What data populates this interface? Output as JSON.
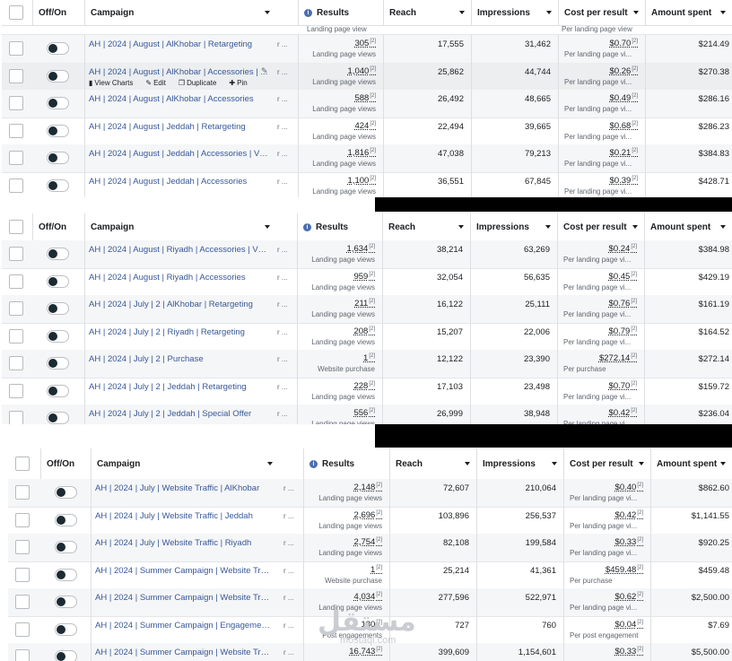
{
  "columns": {
    "toggle": "Off/On",
    "campaign": "Campaign",
    "results": "Results",
    "reach": "Reach",
    "impressions": "Impressions",
    "cpr": "Cost per result",
    "spent": "Amount spent"
  },
  "row_actions": {
    "view_charts": "View Charts",
    "edit": "Edit",
    "duplicate": "Duplicate",
    "pin": "Pin"
  },
  "truncation_text": "r ...",
  "panel1": {
    "top_partial": {
      "results_sub": "Landing page view",
      "cpr_sub": "Per landing page view"
    },
    "rows": [
      {
        "campaign": "AH | 2024 | August | AlKhobar | Retargeting",
        "results": "305",
        "results_sub": "Landing page views",
        "reach": "17,555",
        "impressions": "31,462",
        "cpr": "$0.70",
        "cpr_sub": "Per landing page vi...",
        "spent": "$214.49"
      },
      {
        "campaign": "AH | 2024 | August | AlKhobar | Accessories | ...",
        "results": "1,040",
        "results_sub": "Landing page views",
        "reach": "25,862",
        "impressions": "44,744",
        "cpr": "$0.26",
        "cpr_sub": "Per landing page vi...",
        "spent": "$270.38"
      },
      {
        "campaign": "AH | 2024 | August | AlKhobar | Accessories",
        "results": "588",
        "results_sub": "Landing page views",
        "reach": "26,492",
        "impressions": "48,665",
        "cpr": "$0.49",
        "cpr_sub": "Per landing page vi...",
        "spent": "$286.16"
      },
      {
        "campaign": "AH | 2024 | August | Jeddah | Retargeting",
        "results": "424",
        "results_sub": "Landing page views",
        "reach": "22,494",
        "impressions": "39,665",
        "cpr": "$0.68",
        "cpr_sub": "Per landing page vi...",
        "spent": "$286.23"
      },
      {
        "campaign": "AH | 2024 | August | Jeddah | Accessories | Vide...",
        "results": "1,816",
        "results_sub": "Landing page views",
        "reach": "47,038",
        "impressions": "79,213",
        "cpr": "$0.21",
        "cpr_sub": "Per landing page vi...",
        "spent": "$384.83"
      },
      {
        "campaign": "AH | 2024 | August | Jeddah | Accessories",
        "results": "1,100",
        "results_sub": "Landing page views",
        "reach": "36,551",
        "impressions": "67,845",
        "cpr": "$0.39",
        "cpr_sub": "Per landing page vi...",
        "spent": "$428.71"
      }
    ]
  },
  "panel2": {
    "rows": [
      {
        "campaign": "AH | 2024 | August | Riyadh | Accessories | Vide...",
        "results": "1,634",
        "results_sub": "Landing page views",
        "reach": "38,214",
        "impressions": "63,269",
        "cpr": "$0.24",
        "cpr_sub": "Per landing page vi...",
        "spent": "$384.98"
      },
      {
        "campaign": "AH | 2024 | August | Riyadh | Accessories",
        "results": "959",
        "results_sub": "Landing page views",
        "reach": "32,054",
        "impressions": "56,635",
        "cpr": "$0.45",
        "cpr_sub": "Per landing page vi...",
        "spent": "$429.19"
      },
      {
        "campaign": "AH | 2024 | July | 2 | AlKhobar | Retargeting",
        "results": "211",
        "results_sub": "Landing page views",
        "reach": "16,122",
        "impressions": "25,111",
        "cpr": "$0.76",
        "cpr_sub": "Per landing page vi...",
        "spent": "$161.19"
      },
      {
        "campaign": "AH | 2024 | July | 2 | Riyadh | Retargeting",
        "results": "208",
        "results_sub": "Landing page views",
        "reach": "15,207",
        "impressions": "22,006",
        "cpr": "$0.79",
        "cpr_sub": "Per landing page vi...",
        "spent": "$164.52"
      },
      {
        "campaign": "AH | 2024 | July | 2 | Purchase",
        "results": "1",
        "results_sub": "Website purchase",
        "reach": "12,122",
        "impressions": "23,390",
        "cpr": "$272.14",
        "cpr_sub": "Per purchase",
        "spent": "$272.14"
      },
      {
        "campaign": "AH | 2024 | July | 2 | Jeddah | Retargeting",
        "results": "228",
        "results_sub": "Landing page views",
        "reach": "17,103",
        "impressions": "23,498",
        "cpr": "$0.70",
        "cpr_sub": "Per landing page vi...",
        "spent": "$159.72"
      },
      {
        "campaign": "AH | 2024 | July | 2 | Jeddah | Special Offer",
        "results": "556",
        "results_sub": "Landing page views",
        "reach": "26,999",
        "impressions": "38,948",
        "cpr": "$0.42",
        "cpr_sub": "Per landing page vi...",
        "spent": "$236.04"
      }
    ]
  },
  "panel3": {
    "rows": [
      {
        "campaign": "AH | 2024 | July | Website Traffic | AlKhobar",
        "results": "2,148",
        "results_sub": "Landing page views",
        "reach": "72,607",
        "impressions": "210,064",
        "cpr": "$0.40",
        "cpr_sub": "Per landing page vi...",
        "spent": "$862.60"
      },
      {
        "campaign": "AH | 2024 | July | Website Traffic | Jeddah",
        "results": "2,696",
        "results_sub": "Landing page views",
        "reach": "103,896",
        "impressions": "256,537",
        "cpr": "$0.42",
        "cpr_sub": "Per landing page vi...",
        "spent": "$1,141.55"
      },
      {
        "campaign": "AH | 2024 | July | Website Traffic | Riyadh",
        "results": "2,754",
        "results_sub": "Landing page views",
        "reach": "82,108",
        "impressions": "199,584",
        "cpr": "$0.33",
        "cpr_sub": "Per landing page vi...",
        "spent": "$920.25"
      },
      {
        "campaign": "AH | 2024 | Summer Campaign | Website Traffix...",
        "results": "1",
        "results_sub": "Website purchase",
        "reach": "25,214",
        "impressions": "41,361",
        "cpr": "$459.48",
        "cpr_sub": "Per purchase",
        "spent": "$459.48"
      },
      {
        "campaign": "AH | 2024 | Summer Campaign | Website Traffic...",
        "results": "4,034",
        "results_sub": "Landing page views",
        "reach": "277,596",
        "impressions": "522,971",
        "cpr": "$0.62",
        "cpr_sub": "Per landing page vi...",
        "spent": "$2,500.00"
      },
      {
        "campaign": "AH | 2024 | Summer Campaign | Engagementx",
        "results": "180",
        "results_sub": "Post engagements",
        "reach": "727",
        "impressions": "760",
        "cpr": "$0.04",
        "cpr_sub": "Per post engagement",
        "spent": "$7.69"
      },
      {
        "campaign": "AH | 2024 | Summer Campaign | Website Traffic...",
        "results": "16,743",
        "results_sub": "",
        "reach": "399,609",
        "impressions": "1,154,601",
        "cpr": "$0.33",
        "cpr_sub": "",
        "spent": "$5,500.00"
      }
    ]
  },
  "watermark": {
    "arabic": "مستقل",
    "latin": "mostaql.com"
  }
}
